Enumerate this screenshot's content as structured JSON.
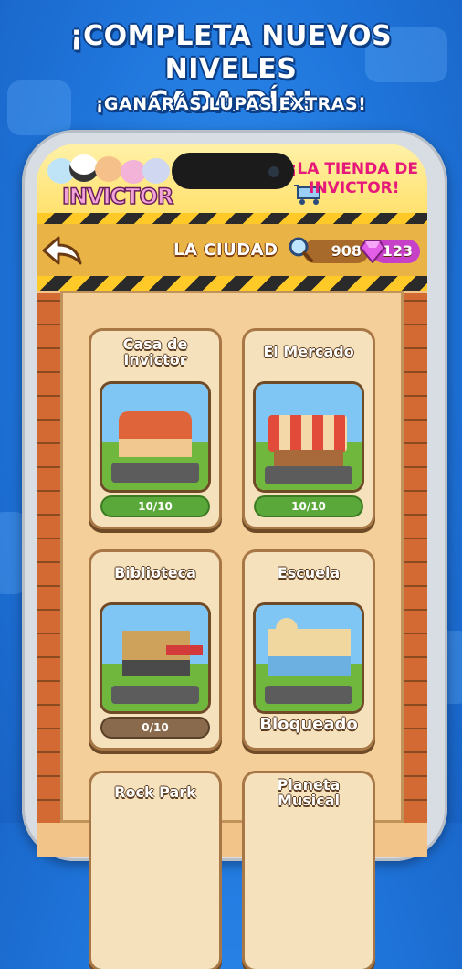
{
  "headline": {
    "line1": "¡COMPLETA NUEVOS NIVELES",
    "line2": "CADA DÍA!",
    "sub": "¡GANARÁS LUPAS EXTRAS!"
  },
  "banner": {
    "logo": "INVICTOR",
    "shop_line1": "¡LA TIENDA DE",
    "shop_line2": "INVICTOR!"
  },
  "topbar": {
    "title": "LA CIUDAD",
    "magnifier_count": "908",
    "gem_count": "123",
    "back_icon": "back-arrow-icon"
  },
  "levels": [
    {
      "title": "Casa de Invictor",
      "status": "10/10",
      "state": "complete"
    },
    {
      "title": "El Mercado",
      "status": "10/10",
      "state": "complete"
    },
    {
      "title": "Biblioteca",
      "status": "0/10",
      "state": "open"
    },
    {
      "title": "Escuela",
      "status": "Bloqueado",
      "state": "locked"
    },
    {
      "title": "Rock Park",
      "status": "",
      "state": "unknown"
    },
    {
      "title": "Planeta Musical",
      "status": "",
      "state": "unknown"
    }
  ],
  "colors": {
    "background": "#1f74da",
    "progress_green": "#5aa83a",
    "gem": "#c640c8"
  }
}
